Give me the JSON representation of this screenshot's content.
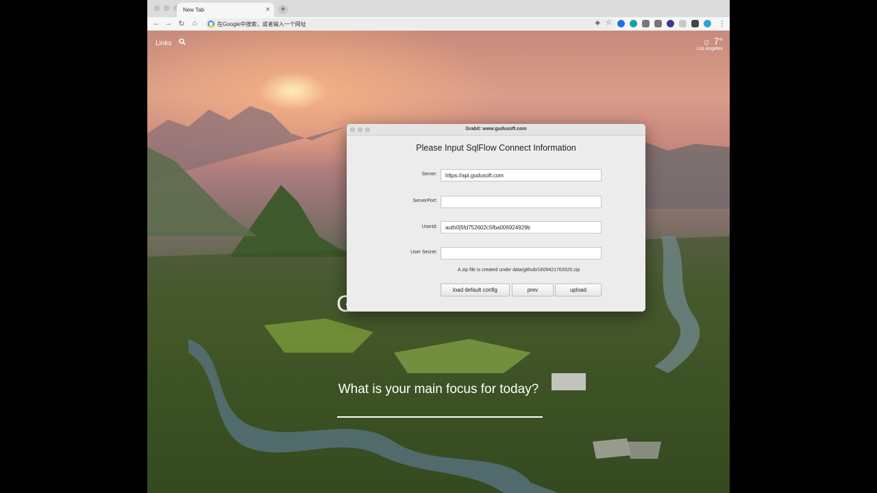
{
  "browser": {
    "tab_title": "New Tab",
    "tab_close": "×",
    "new_tab": "+",
    "nav": {
      "back": "←",
      "forward": "→",
      "reload": "↻",
      "home": "⌂"
    },
    "omnibox_placeholder": "在Google中搜索，或者输入一个网址",
    "omnibox_icons": {
      "lens": "◈",
      "star": "☆"
    },
    "extension_colors": [
      "#1a73e8",
      "#12a4a4",
      "#777777",
      "#777777",
      "#3b3b8f",
      "#c9c9c9",
      "#444444",
      "#2aa6d8"
    ],
    "menu": "⋮"
  },
  "momentum": {
    "links_label": "Links",
    "search_icon": "search-icon",
    "weather_icon": "☼",
    "temperature": "7°",
    "city": "Los Angeles",
    "greeting_partial": "G",
    "focus_question": "What is your main focus for today?"
  },
  "dialog": {
    "window_title": "Grabit: www.gudusoft.com",
    "heading": "Please Input SqlFlow Connect Information",
    "fields": [
      {
        "label": "Server:",
        "value": "https://api.gudusoft.com"
      },
      {
        "label": "ServerPort:",
        "value": ""
      },
      {
        "label": "UserId:",
        "value": "auth0|5fd752602c5fba006924929b"
      },
      {
        "label": "User Secret:",
        "value": ""
      }
    ],
    "zip_note": "A zip file is created under data/github/1609421763320.zip",
    "buttons": {
      "load_default": "load default config",
      "prev": "prev",
      "upload": "upload"
    }
  }
}
